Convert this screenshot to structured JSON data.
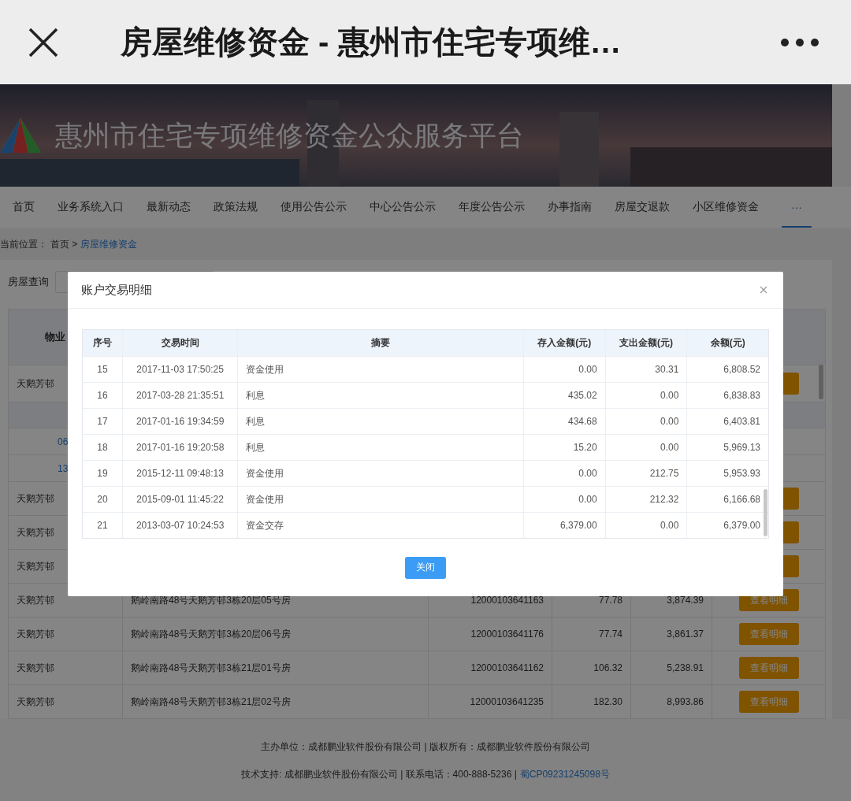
{
  "top_bar": {
    "title": "房屋维修资金 - 惠州市住宅专项维…"
  },
  "banner": {
    "title": "惠州市住宅专项维修资金公众服务平台"
  },
  "nav": [
    {
      "label": "首页",
      "selected": false
    },
    {
      "label": "业务系统入口",
      "selected": false
    },
    {
      "label": "最新动态",
      "selected": false
    },
    {
      "label": "政策法规",
      "selected": false
    },
    {
      "label": "使用公告公示",
      "selected": false
    },
    {
      "label": "中心公告公示",
      "selected": false
    },
    {
      "label": "年度公告公示",
      "selected": false
    },
    {
      "label": "办事指南",
      "selected": false
    },
    {
      "label": "房屋交退款",
      "selected": false
    },
    {
      "label": "小区维修资金",
      "selected": false
    },
    {
      "label": "···",
      "selected": true
    }
  ],
  "breadcrumb": {
    "label": "当前位置：",
    "home": "首页 >",
    "current": "房屋维修资金"
  },
  "search": {
    "label": "房屋查询"
  },
  "house_table": {
    "header": "物业",
    "rows": [
      {
        "kind": "house",
        "estate": "天鹅芳邨"
      },
      {
        "kind": "subheader"
      },
      {
        "kind": "link",
        "text": "06"
      },
      {
        "kind": "link",
        "text": "13"
      },
      {
        "kind": "house",
        "estate": "天鹅芳邨"
      },
      {
        "kind": "house",
        "estate": "天鹅芳邨"
      },
      {
        "kind": "house",
        "estate": "天鹅芳邨"
      },
      {
        "kind": "house",
        "estate": "天鹅芳邨",
        "address": "鹅岭南路48号天鹅芳邨3栋20层05号房",
        "account": "12000103641163",
        "area": "77.78",
        "balance": "3,874.39",
        "action": "查看明细"
      },
      {
        "kind": "house",
        "estate": "天鹅芳邨",
        "address": "鹅岭南路48号天鹅芳邨3栋20层06号房",
        "account": "12000103641176",
        "area": "77.74",
        "balance": "3,861.37",
        "action": "查看明细"
      },
      {
        "kind": "house",
        "estate": "天鹅芳邨",
        "address": "鹅岭南路48号天鹅芳邨3栋21层01号房",
        "account": "12000103641162",
        "area": "106.32",
        "balance": "5,238.91",
        "action": "查看明细"
      },
      {
        "kind": "house",
        "estate": "天鹅芳邨",
        "address": "鹅岭南路48号天鹅芳邨3栋21层02号房",
        "account": "12000103641235",
        "area": "182.30",
        "balance": "8,993.86",
        "action": "查看明细"
      }
    ]
  },
  "footer": {
    "line_1": "主办单位：成都鹏业软件股份有限公司 | 版权所有：成都鹏业软件股份有限公司",
    "line_2": "技术支持: 成都鹏业软件股份有限公司 | 联系电话：400-888-5236 |",
    "license_link": "蜀CP09231245098号"
  },
  "dialog": {
    "title": "账户交易明细",
    "columns": [
      "序号",
      "交易时间",
      "摘要",
      "存入金额(元)",
      "支出金额(元)",
      "余额(元)"
    ],
    "rows": [
      [
        "15",
        "2017-11-03 17:50:25",
        "资金使用",
        "0.00",
        "30.31",
        "6,808.52"
      ],
      [
        "16",
        "2017-03-28 21:35:51",
        "利息",
        "435.02",
        "0.00",
        "6,838.83"
      ],
      [
        "17",
        "2017-01-16 19:34:59",
        "利息",
        "434.68",
        "0.00",
        "6,403.81"
      ],
      [
        "18",
        "2017-01-16 19:20:58",
        "利息",
        "15.20",
        "0.00",
        "5,969.13"
      ],
      [
        "19",
        "2015-12-11 09:48:13",
        "资金使用",
        "0.00",
        "212.75",
        "5,953.93"
      ],
      [
        "20",
        "2015-09-01 11:45:22",
        "资金使用",
        "0.00",
        "212.32",
        "6,166.68"
      ],
      [
        "21",
        "2013-03-07 10:24:53",
        "资金交存",
        "6,379.00",
        "0.00",
        "6,379.00"
      ]
    ],
    "close_button": "关闭"
  }
}
